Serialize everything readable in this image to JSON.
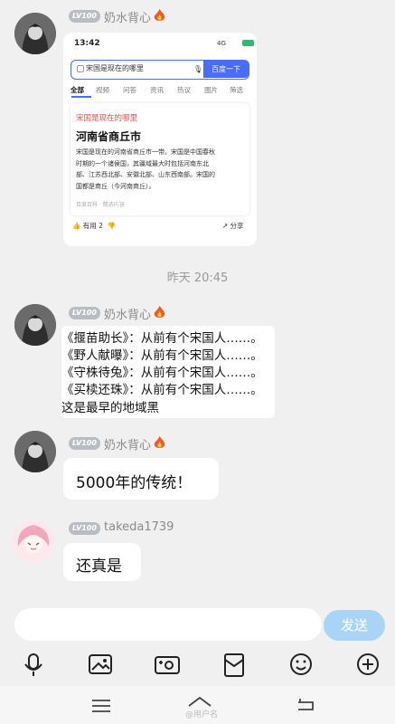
{
  "messages": [
    {
      "user": "奶水背心",
      "level": "LV100",
      "type": "image"
    },
    {
      "user": "奶水背心",
      "level": "LV100",
      "type": "text",
      "lines": [
        "《揠苗助长》：从前有个宋国人……。",
        "《野人献曝》：从前有个宋国人……。",
        "《守株待兔》：从前有个宋国人……。",
        "《买椟还珠》：从前有个宋国人……。",
        "这是最早的地域黑"
      ]
    },
    {
      "user": "奶水背心",
      "level": "LV100",
      "type": "text",
      "text": "5000年的传统！"
    },
    {
      "user": "takeda1739",
      "level": "LV100",
      "type": "text",
      "text": "还真是"
    }
  ],
  "timestamp": "昨天 20:45",
  "screenshot": {
    "time": "13:42",
    "status": "4G",
    "battery": "",
    "query": "宋国是现在的哪里",
    "search_button": "百度一下",
    "tabs": [
      "全部",
      "视频",
      "问答",
      "资讯",
      "热议",
      "图片",
      "筛选"
    ],
    "result_question": "宋国是现在的哪里",
    "result_answer": "河南省商丘市",
    "result_lines": [
      "宋国是现在的河南省商丘市一带。宋国是中国春秋",
      "时期的一个诸侯国，其疆域最大时包括河南东北",
      "部、江苏西北部、安徽北部、山东西南部。宋国的",
      "国都是商丘（今河南商丘）。"
    ],
    "result_source": "百度百科 · 精选内容",
    "useful": "有用 2",
    "share": "分享"
  },
  "input": {
    "send_label": "发送"
  },
  "watermark": "@用户名",
  "colors": {
    "accent": "#4a6cf7",
    "send_button": "#a9d4f5",
    "level_badge": "#b8bdc4"
  }
}
